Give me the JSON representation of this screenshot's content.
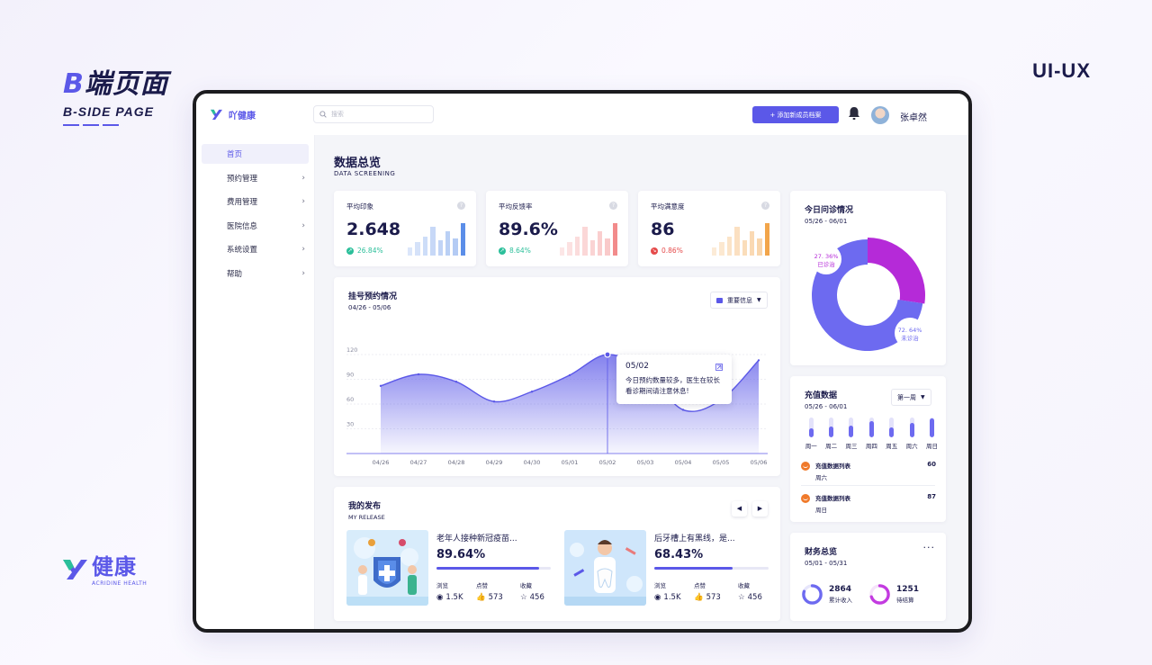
{
  "showcase": {
    "title_b": "B",
    "title_rest": "端页面",
    "subtitle": "B-SIDE PAGE",
    "uiux": "UI-UX",
    "footer_brand": "健康",
    "footer_brand_en": "ACRIDINE HEALTH"
  },
  "topbar": {
    "brand": "吖健康",
    "search_placeholder": "搜索",
    "add_button": "+ 添加新成员档案",
    "user_name": "张卓然"
  },
  "sidebar": {
    "items": [
      {
        "label": "首页",
        "active": true
      },
      {
        "label": "预约管理"
      },
      {
        "label": "费用管理"
      },
      {
        "label": "医院信息"
      },
      {
        "label": "系统设置"
      },
      {
        "label": "帮助"
      }
    ]
  },
  "page": {
    "title": "数据总览",
    "subtitle": "DATA SCREENING"
  },
  "kpis": [
    {
      "label": "平均印象",
      "value": "2.648",
      "trend": "26.84%",
      "direction": "up",
      "color": "#2bbf9a",
      "bar_color": "#5b8ee8",
      "bars": [
        0.25,
        0.4,
        0.55,
        0.85,
        0.45,
        0.7,
        0.5,
        0.95
      ]
    },
    {
      "label": "平均反馈率",
      "value": "89.6%",
      "trend": "8.64%",
      "direction": "up",
      "color": "#2bbf9a",
      "bar_color": "#f28b8b",
      "bars": [
        0.25,
        0.4,
        0.55,
        0.85,
        0.45,
        0.7,
        0.5,
        0.95
      ]
    },
    {
      "label": "平均满意度",
      "value": "86",
      "trend": "0.86%",
      "direction": "down",
      "color": "#e54b4b",
      "bar_color": "#f2a54a",
      "bars": [
        0.25,
        0.4,
        0.55,
        0.85,
        0.45,
        0.7,
        0.5,
        0.95
      ]
    }
  ],
  "registration": {
    "title": "挂号预约情况",
    "range": "04/26 - 05/06",
    "filter": "重要信息",
    "tooltip_date": "05/02",
    "tooltip_text": "今日预约数量较多，医生在较长看诊期间请注意休息!"
  },
  "chart_data": {
    "type": "area",
    "x": [
      "04/26",
      "04/27",
      "04/28",
      "04/29",
      "04/30",
      "05/01",
      "05/02",
      "05/03",
      "05/04",
      "05/05",
      "05/06"
    ],
    "series": [
      {
        "values": [
          82,
          96,
          87,
          63,
          75,
          95,
          120,
          100,
          53,
          65,
          113
        ]
      }
    ],
    "yticks": [
      30,
      60,
      90,
      120
    ],
    "ylim": [
      0,
      120
    ],
    "highlight_x": "05/02",
    "accent": "#5b58e8"
  },
  "today": {
    "title": "今日问诊情况",
    "range": "05/26 - 06/01",
    "segments": [
      {
        "label": "已诊治",
        "value": 27.36,
        "text": "27. 36%",
        "color": "#b52ad8"
      },
      {
        "label": "未诊治",
        "value": 72.64,
        "text": "72. 64%",
        "color": "#6d6af0"
      }
    ]
  },
  "topup": {
    "title": "充值数据",
    "range": "05/26 - 06/01",
    "period": "第一周",
    "days": [
      {
        "label": "周一",
        "level": 0.45
      },
      {
        "label": "周二",
        "level": 0.55
      },
      {
        "label": "周三",
        "level": 0.6
      },
      {
        "label": "周四",
        "level": 0.8
      },
      {
        "label": "周五",
        "level": 0.5
      },
      {
        "label": "周六",
        "level": 0.75
      },
      {
        "label": "周日",
        "level": 0.95
      }
    ],
    "items": [
      {
        "title": "充值数据列表",
        "day": "周六",
        "value": "60"
      },
      {
        "title": "充值数据列表",
        "day": "周日",
        "value": "87"
      }
    ]
  },
  "release": {
    "title": "我的发布",
    "subtitle": "MY RELEASE",
    "stat_labels": [
      "浏览",
      "点赞",
      "收藏"
    ],
    "posts": [
      {
        "title": "老年人接种新冠疫苗...",
        "percent_text": "89.64%",
        "percent": 0.8964,
        "views": "1.5K",
        "likes": "573",
        "favs": "456"
      },
      {
        "title": "后牙槽上有黑线，是...",
        "percent_text": "68.43%",
        "percent": 0.6843,
        "views": "1.5K",
        "likes": "573",
        "favs": "456"
      }
    ]
  },
  "finance": {
    "title": "财务总览",
    "range": "05/01 - 05/31",
    "items": [
      {
        "value": "2864",
        "label": "累计收入",
        "color": "#6d6af0",
        "level": 0.8
      },
      {
        "value": "1251",
        "label": "待结算",
        "color": "#c33be0",
        "level": 0.7
      }
    ]
  }
}
